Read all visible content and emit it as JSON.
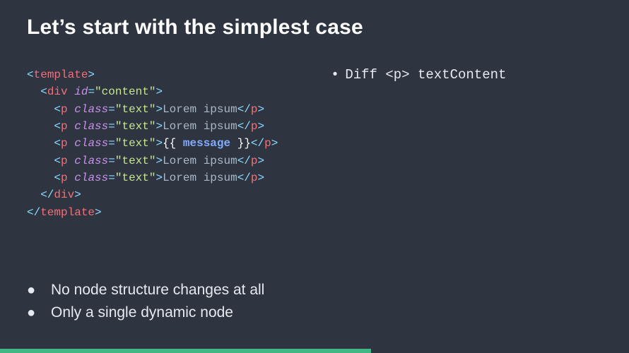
{
  "title": "Let’s start with the simplest case",
  "code": {
    "tag_template": "template",
    "tag_div": "div",
    "tag_p": "p",
    "attr_id": "id",
    "attr_class": "class",
    "val_content": "\"content\"",
    "val_text": "\"text\"",
    "txt_lorem": "Lorem ipsum",
    "mustache_open": "{{ ",
    "var_message": "message",
    "mustache_close": " }}"
  },
  "right": {
    "line1_a": "Diff ",
    "line1_b": "<p>",
    "line1_c": " textContent"
  },
  "bottom": {
    "b1": "No node structure changes at all",
    "b2": "Only a single dynamic node"
  },
  "progress_pct": 59
}
